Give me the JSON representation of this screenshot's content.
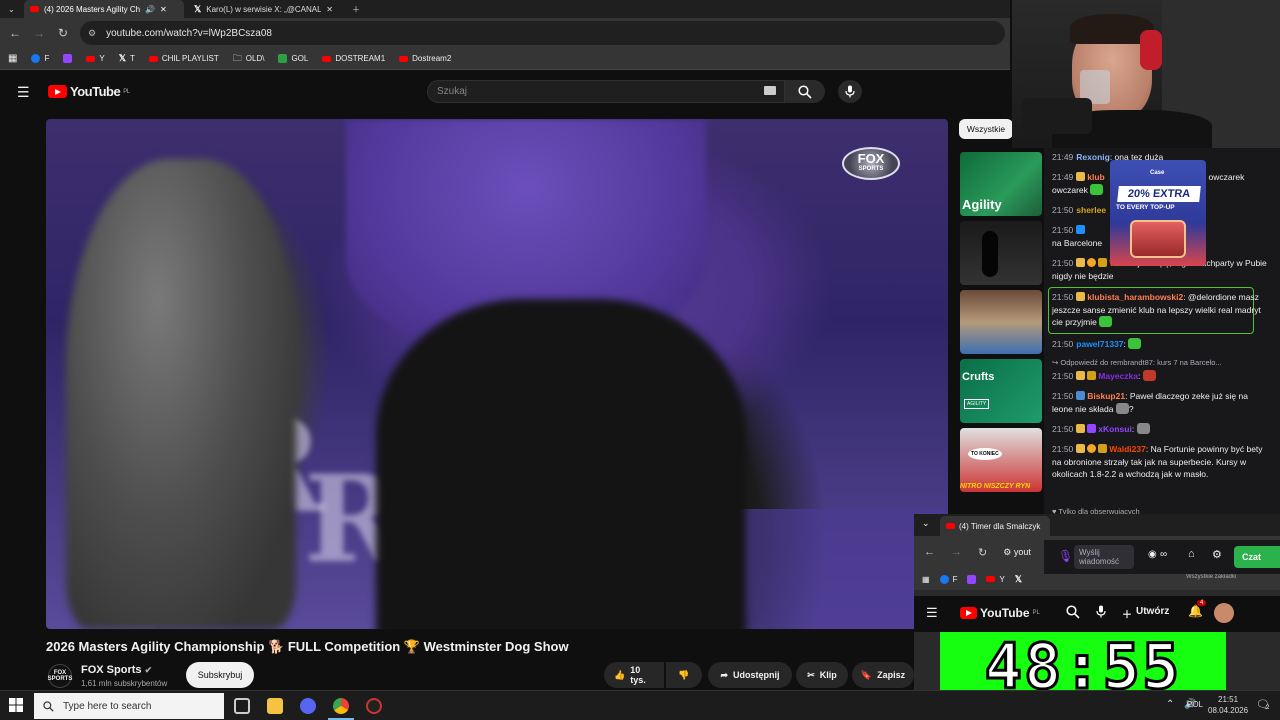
{
  "browser": {
    "tabs": [
      {
        "title": "(4) 2026 Masters Agility Ch"
      },
      {
        "title": "Karo(L) w serwisie X: „@CANAL"
      }
    ],
    "url": "youtube.com/watch?v=lWp2BCsza08",
    "bookmarks": [
      "F",
      "Y",
      "T",
      "CHIL PLAYLIST",
      "OLD\\",
      "GOL",
      "DOSTREAM1",
      "Dostream2"
    ]
  },
  "youtube": {
    "logo_text": "YouTube",
    "region": "PL",
    "search_placeholder": "Szukaj",
    "video_title": "2026 Masters Agility Championship 🐕 FULL Competition 🏆 Westminster Dog Show",
    "channel_name": "FOX Sports",
    "channel_logo": "FOX SPORTS",
    "channel_subs": "1,61 mln subskrybentów",
    "subscribe_label": "Subskrybuj",
    "likes": "10 tys.",
    "share_label": "Udostępnij",
    "clip_label": "Klip",
    "save_label": "Zapisz",
    "filter_chip": "Wszystkie",
    "video_overlay": {
      "fox_line1": "FOX",
      "fox_line2": "SPORTS",
      "letter": "R"
    },
    "thumbnails": [
      {
        "label": "Agility"
      },
      {
        "label": ""
      },
      {
        "label": ""
      },
      {
        "label": "Crufts",
        "sub": "AGILITY"
      },
      {
        "label": "NITRO NISZCZY RYN",
        "sub": "TO KONIEC"
      }
    ]
  },
  "chat": {
    "messages": [
      {
        "time": "21:49",
        "user": "Rexonig",
        "text": "ona tez duża",
        "color": "#8ab4f8"
      },
      {
        "time": "21:49",
        "user": "klub",
        "text": "ny owczarek",
        "color": "#ff7f50"
      },
      {
        "time": "21:50",
        "user": "sherlee",
        "text": "",
        "color": "#daa520"
      },
      {
        "time": "21:50",
        "user": "",
        "text": "na Barcelone",
        "color": "#8ab4f8"
      },
      {
        "time": "21:50",
        "user": "Wa",
        "text": "chuj w dupę, tego watchparty w Pubie nigdy nie będzie",
        "color": "#ff4500"
      },
      {
        "time": "21:50",
        "user": "klubista_harambowski2",
        "text": "@delordione masz jeszcze sanse zmienić klub na lepszy wielki real madryt cie przyjmie",
        "color": "#ff7f50"
      },
      {
        "time": "21:50",
        "user": "pawel71337",
        "text": "",
        "color": "#1e90ff"
      },
      {
        "time": "21:50",
        "user": "Mayeczka",
        "text": "",
        "color": "#8a2be2"
      },
      {
        "time": "21:50",
        "user": "Biskup21",
        "text": "Paweł dlaczego zeke już się na leone nie składa",
        "color": "#ff7f50"
      },
      {
        "time": "21:50",
        "user": "xKonsui",
        "text": "",
        "color": "#9146ff"
      },
      {
        "time": "21:50",
        "user": "Waldi237",
        "text": "Na Fortunie powinny być bety na obronione strzały tak jak na superbecie. Kursy w okolicach 1.8-2.2 a wchodzą jak w masło.",
        "color": "#ff4500"
      }
    ],
    "reply_note": "Odpowiedź do rembrandt87: kurs 7 na Barcelo...",
    "reply_suffix": "?",
    "followers_only": "Tylko dla obserwujących",
    "input_placeholder": "Wyślij wiadomość",
    "chat_button": "Czat",
    "ad": {
      "brand": "Case",
      "line1": "20% EXTRA",
      "line2": "TO EVERY TOP-UP"
    }
  },
  "mini_browser": {
    "tab_title": "(4) Timer dla Smalczyk",
    "url_partial": "yout",
    "bookmarks": [
      "F",
      "Y",
      "X"
    ],
    "partial_text": "Wszystkie zakładki",
    "create_label": "Utwórz",
    "notif_count": "4",
    "timer": "48:55"
  },
  "taskbar": {
    "search_placeholder": "Type here to search",
    "language": "POL",
    "time": "21:51",
    "date": "08.04.2026",
    "notifications": "2"
  },
  "colors": {
    "yt_red": "#ff0000",
    "twitch_purple": "#9146ff",
    "timer_green": "#17ff10",
    "chat_highlight": "#4fc72c"
  }
}
